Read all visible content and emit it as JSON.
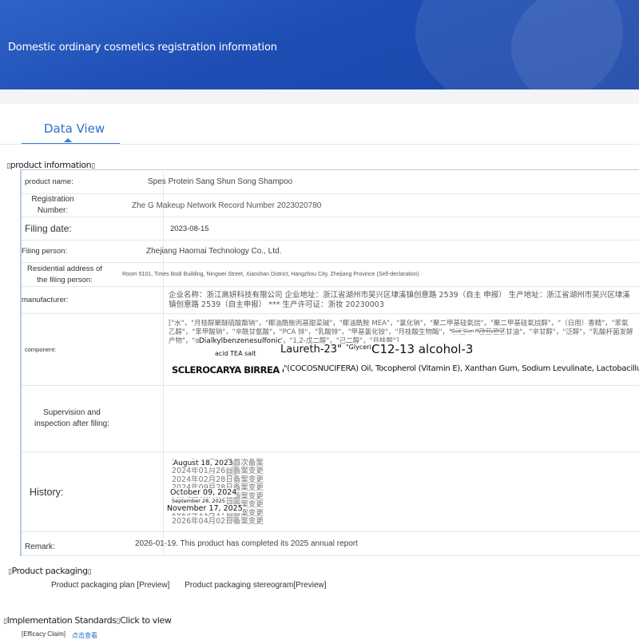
{
  "header": {
    "title": "Domestic ordinary cosmetics registration information"
  },
  "tabs": [
    {
      "label": "Data View",
      "active": true
    }
  ],
  "sections": {
    "product_info": "product information",
    "packaging": "Product packaging",
    "standards": "Implementation Standards",
    "standards_link": "Click to view"
  },
  "fields": {
    "product_name_label": "product name:",
    "product_name": "Spes Protein Sang Shun Song Shampoo",
    "registration_label": "Registration Number:",
    "registration": "Zhe G Makeup Network Record Number 2023020780",
    "filing_date_label": "Filing date:",
    "filing_date": "2023-08-15",
    "filing_person_label": "Filing person:",
    "filing_person": "Zhejiang Haomai Technology Co., Ltd.",
    "residential_label": "Residential address of the filing person:",
    "residential": "Room 5101, Times Bodi Building, Ningwei Street, Xiaoshan District, Hangzhou City, Zhejiang Province (Self-declaration)",
    "manufacturer_label": "manufacturer:",
    "manufacturer": "企业名称：浙江高妍科技有限公司 企业地址：浙江省湖州市吴兴区埭溪镇创意路 2539（自主 申报） 生产地址：浙江省湖州市吴兴区埭溪镇创意路 2539（自主申报） *** 生产许可证：浙妆 20230003",
    "component_label": "component:",
    "component_bg": "[\"水\"，\"月桂醇聚醚硫酸酯钠\"，\"椰油酰胺丙基甜菜碱\"，\"椰油酰胺 MEA\"，\"氯化钠\"，\"聚二甲基硅氧烷\"，\"聚二甲基硅氧烷醇\"，\"（日用）香精\"，\"苯氧乙醇\"，\"苯甲酸钠\"，\"辛酰甘氨酸\"，\"PCA 锌\"，\"乳酸锌\"，\"甲基氯化铵\"，\"月桂酸生物酶\"，\"甘油\"，\"乙基己基甘油\"，\"辛甘醇\"，\"泛醇\"，\"乳酸杆菌发酵产物\"，\"α-葡聚糖寡糖\"，\"CI 19140\"，\"1,2-戊二醇\"，\"己二醇\"，\"月桂酸\"]",
    "component_overlays": {
      "guar": "Guar Gum Hydroxyethyl",
      "dialkyl": "Dialkylbenzenesulfonic",
      "acid_tea": "acid TEA salt",
      "laureth": "Laureth-23\"",
      "glycerin": "\"Glycerin\"",
      "c12": "C12-13 alcohol-3",
      "sclerocarya": "SCLEROCARYA BIRREA oil",
      "cocos": "\"(COCOSNUCIFERA) Oil, Tocopherol (Vitamin E), Xanthan Gum, Sodium Levulinate, Lactobacillus"
    },
    "supervision_label": "Supervision and inspection after filing:",
    "history_label": "History:",
    "history_bg": [
      "2023年08月15日首次备案",
      "2024年01月26日备案变更",
      "2024年02月28日备案变更",
      "2024年09月28日备案变更",
      "2024年10月09日备案变更",
      "2025年09月28日备案变更",
      "2025年11月17日备案变更",
      "2026年04月02日备案变更"
    ],
    "history_dates": {
      "aug": "August 18, 2023",
      "oct": "October 09, 2024",
      "sep": "September 28, 2025",
      "nov": "November 17, 2025"
    },
    "remark_label": "Remark:",
    "remark": "2026-01-19. This product has completed its 2025 annual report"
  },
  "packaging": {
    "plan": "Product packaging plan [Preview]",
    "stereogram": "Product packaging stereogram[Preview]"
  },
  "standards": {
    "efficacy_tag": "[Efficacy Claim]",
    "efficacy_link": "点击查看"
  }
}
